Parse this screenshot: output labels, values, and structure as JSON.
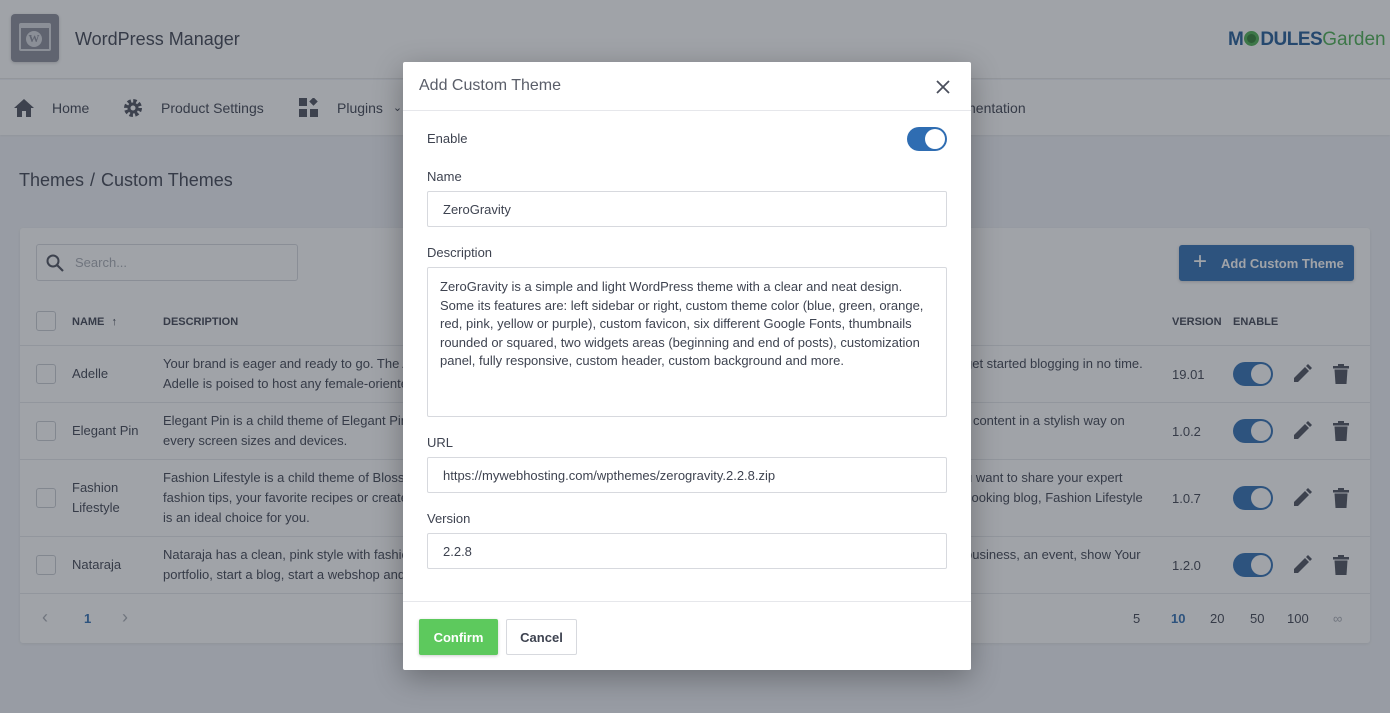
{
  "header": {
    "app_title": "WordPress Manager",
    "brand_left": "M",
    "brand_mid": "DULES",
    "brand_right": "Garden"
  },
  "nav": {
    "items": [
      {
        "label": "Home",
        "icon": "home-icon"
      },
      {
        "label": "Product Settings",
        "icon": "gear-icon"
      },
      {
        "label": "Plugins",
        "icon": "widgets-icon"
      },
      {
        "label": "nentation",
        "icon": ""
      }
    ]
  },
  "breadcrumb": {
    "parent": "Themes",
    "separator": "/",
    "current": "Custom Themes"
  },
  "table": {
    "search_placeholder": "Search...",
    "add_button": "Add Custom Theme",
    "columns": {
      "name": "NAME",
      "sort_arrow": "↑",
      "description": "DESCRIPTION",
      "version": "VERSION",
      "enable": "ENABLE"
    },
    "rows": [
      {
        "name": "Adelle",
        "desc_left": [
          "Your brand is eager and ready to go. The A",
          "Adelle is poised to host any female-oriente"
        ],
        "desc_right": [
          "get started blogging in no time.",
          ""
        ],
        "version": "19.01",
        "enabled": true
      },
      {
        "name": "Elegant Pin",
        "desc_left": [
          "Elegant Pin is a child theme of Elegant Pin",
          "every screen sizes and devices."
        ],
        "desc_right": [
          "r content in a stylish way on",
          ""
        ],
        "version": "1.0.2",
        "enabled": true
      },
      {
        "name_lines": [
          "Fashion",
          "Lifestyle"
        ],
        "desc_left": [
          "Fashion Lifestyle is a child theme of Bloss",
          "fashion tips, your favorite recipes or create",
          "is an ideal choice for you."
        ],
        "desc_right": [
          "u want to share your expert",
          "cooking blog, Fashion Lifestyle",
          ""
        ],
        "version": "1.0.7",
        "enabled": true
      },
      {
        "name": "Nataraja",
        "desc_left": [
          "Nataraja has a clean, pink style with fashic",
          "portfolio, start a blog, start a webshop and"
        ],
        "desc_right": [
          "business, an event, show Your",
          ""
        ],
        "version": "1.2.0",
        "enabled": true
      }
    ],
    "pagination": {
      "prev": "‹",
      "current_page": "1",
      "next": "›",
      "page_sizes": [
        "5",
        "10",
        "20",
        "50",
        "100",
        "∞"
      ],
      "active_page_size": "10"
    }
  },
  "modal": {
    "title": "Add Custom Theme",
    "enable_label": "Enable",
    "enable_value": true,
    "name_label": "Name",
    "name_value": "ZeroGravity",
    "description_label": "Description",
    "description_value": "ZeroGravity is a simple and light WordPress theme with a clear and neat design. Some its features are: left sidebar or right, custom theme color (blue, green, orange, red, pink, yellow or purple), custom favicon, six different Google Fonts, thumbnails rounded or squared, two widgets areas (beginning and end of posts), customization panel, fully responsive, custom header, custom background and more.",
    "url_label": "URL",
    "url_value": "https://mywebhosting.com/wpthemes/zerogravity.2.2.8.zip",
    "version_label": "Version",
    "version_value": "2.2.8",
    "confirm": "Confirm",
    "cancel": "Cancel"
  },
  "colors": {
    "primary": "#2f6db2",
    "confirm_green": "#5dc95d",
    "brand_blue": "#1f5a96",
    "brand_green": "#4caf50"
  }
}
